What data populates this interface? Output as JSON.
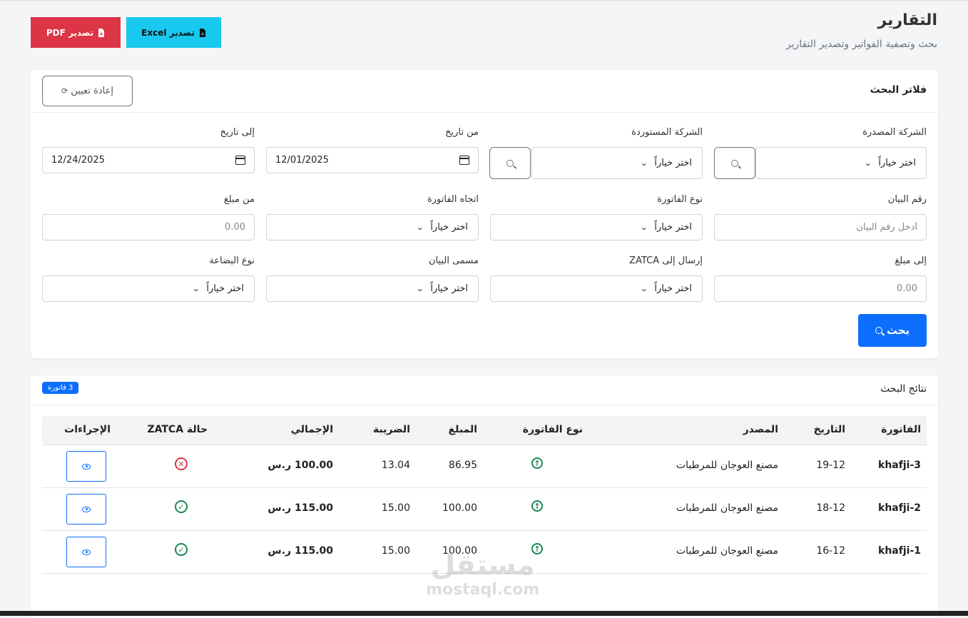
{
  "header": {
    "title": "التقارير",
    "subtitle": "بحث وتصفية الفواتير وتصدير التقارير",
    "export_pdf_label": "تصدير PDF",
    "export_excel_label": "تصدير Excel"
  },
  "filters": {
    "title": "فلاتر البحث",
    "reset_label": "إعادة تعيين",
    "issuer_company": {
      "label": "الشركة المصدرة",
      "value": "اختر خياراً"
    },
    "importer_company": {
      "label": "الشركة المستوردة",
      "value": "اختر خياراً"
    },
    "from_date": {
      "label": "من تاريخ",
      "value": "12/01/2025"
    },
    "to_date": {
      "label": "إلى تاريخ",
      "value": "12/24/2025"
    },
    "statement_number": {
      "label": "رقم البيان",
      "placeholder": "أدخل رقم البيان"
    },
    "invoice_type": {
      "label": "نوع الفاتورة",
      "value": "اختر خياراً"
    },
    "invoice_direction": {
      "label": "اتجاه الفاتورة",
      "value": "اختر خياراً"
    },
    "amount_from": {
      "label": "من مبلغ",
      "placeholder": "0.00"
    },
    "amount_to": {
      "label": "إلى مبلغ",
      "placeholder": "0.00"
    },
    "zatca_sent": {
      "label": "إرسال إلى ZATCA",
      "value": "اختر خياراً"
    },
    "statement_name": {
      "label": "مسمى البيان",
      "value": "اختر خياراً"
    },
    "goods_type": {
      "label": "نوع البضاعة",
      "value": "اختر خياراً"
    },
    "search_label": "بحث"
  },
  "results": {
    "title": "نتائج البحث",
    "count_badge": "3 فاتورة",
    "columns": [
      "الفاتورة",
      "التاريخ",
      "المصدر",
      "نوع الفاتورة",
      "المبلغ",
      "الضريبة",
      "الإجمالي",
      "حالة ZATCA",
      "الإجراءات"
    ],
    "rows": [
      {
        "invoice": "khafji-3",
        "date": "19-12",
        "source": "مصنع العوجان للمرطبات",
        "type_icon": "arrow-up-circle-icon",
        "amount": "86.95",
        "tax": "13.04",
        "total": "100.00 ر.س",
        "zatca_status": "failed"
      },
      {
        "invoice": "khafji-2",
        "date": "18-12",
        "source": "مصنع العوجان للمرطبات",
        "type_icon": "arrow-up-circle-icon",
        "amount": "100.00",
        "tax": "15.00",
        "total": "115.00 ر.س",
        "zatca_status": "success"
      },
      {
        "invoice": "khafji-1",
        "date": "16-12",
        "source": "مصنع العوجان للمرطبات",
        "type_icon": "arrow-up-circle-icon",
        "amount": "100.00",
        "tax": "15.00",
        "total": "115.00 ر.س",
        "zatca_status": "success"
      }
    ]
  },
  "watermark": {
    "arabic": "مستقل",
    "latin": "mostaql.com"
  },
  "colors": {
    "primary": "#0d6efd",
    "danger": "#dc3545",
    "info": "#17c9ef",
    "success": "#198754"
  }
}
